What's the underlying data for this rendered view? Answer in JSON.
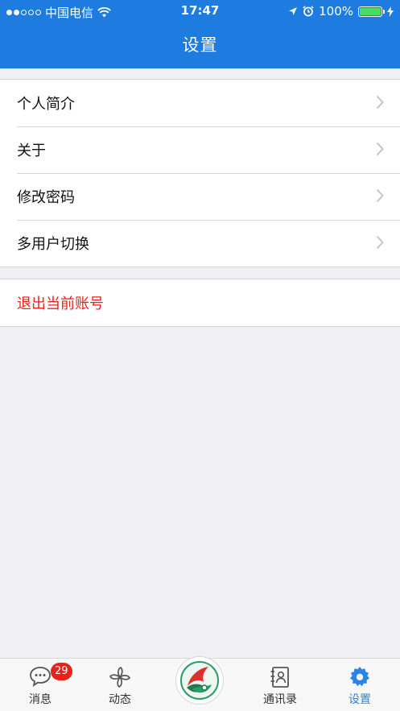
{
  "status_bar": {
    "carrier": "中国电信",
    "time": "17:47",
    "battery_percent": "100%",
    "battery_level": 1.0,
    "signal_strength": 2,
    "signal_total": 5
  },
  "nav": {
    "title": "设置"
  },
  "settings": {
    "items": [
      {
        "label": "个人简介"
      },
      {
        "label": "关于"
      },
      {
        "label": "修改密码"
      },
      {
        "label": "多用户切换"
      }
    ],
    "logout_label": "退出当前账号"
  },
  "tabbar": {
    "tabs": [
      {
        "label": "消息",
        "icon": "chat-bubble-icon",
        "badge": "29"
      },
      {
        "label": "动态",
        "icon": "pinwheel-icon"
      },
      {
        "label": "",
        "icon": "app-logo-icon"
      },
      {
        "label": "通讯录",
        "icon": "contacts-book-icon"
      },
      {
        "label": "设置",
        "icon": "gear-icon",
        "active": true
      }
    ]
  },
  "colors": {
    "nav_background": "#1e7be0",
    "logout_text": "#e8211a",
    "active_tab": "#2a84e8",
    "badge": "#e8211a",
    "battery_fill": "#4cd964"
  }
}
